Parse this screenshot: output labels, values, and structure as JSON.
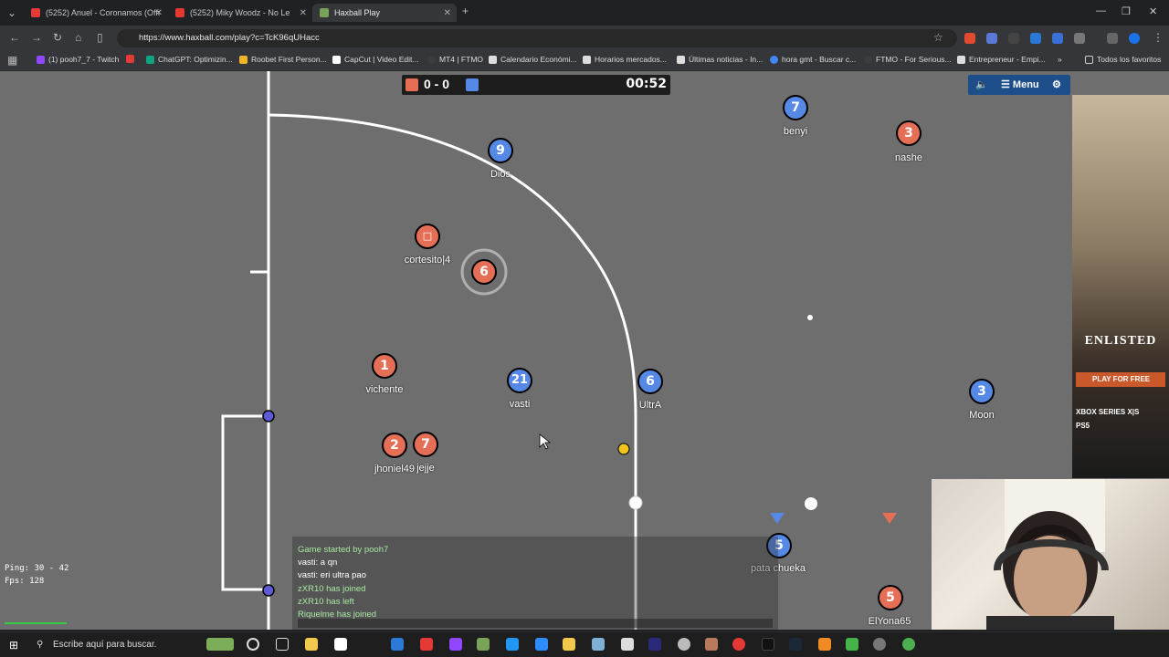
{
  "browser": {
    "tabs": [
      {
        "title": "(5252) Anuel - Coronamos (Offi",
        "color": "#e53935"
      },
      {
        "title": "(5252) Miky Woodz - No Le",
        "color": "#e53935"
      },
      {
        "title": "Haxball Play",
        "color": "#7aa35a"
      }
    ],
    "new_tab_glyph": "+",
    "url": "https://www.haxball.com/play?c=TcK96qUHacc",
    "bookmarks": [
      {
        "label": "(1) pooh7_7 - Twitch",
        "color": "#9146ff"
      },
      {
        "label": "ChatGPT: Optimizin...",
        "color": "#10a37f"
      },
      {
        "label": "Roobet First Person...",
        "color": "#f0b429"
      },
      {
        "label": "CapCut | Video Edit...",
        "color": "#ffffff"
      },
      {
        "label": "MT4 | FTMO",
        "color": "#3c3c3c"
      },
      {
        "label": "Calendario Económi...",
        "color": "#dddddd"
      },
      {
        "label": "Horarios mercados...",
        "color": "#dddddd"
      },
      {
        "label": "Últimas noticias - In...",
        "color": "#dddddd"
      },
      {
        "label": "hora gmt - Buscar c...",
        "color": "#4285f4"
      },
      {
        "label": "FTMO - For Serious...",
        "color": "#3c3c3c"
      },
      {
        "label": "Entrepreneur - Empi...",
        "color": "#dddddd"
      }
    ],
    "all_bookmarks": "Todos los favoritos"
  },
  "game": {
    "score": "0 - 0",
    "timer": "00:52",
    "red_color": "#e56e56",
    "blue_color": "#5689e5",
    "menu_label": "Menu",
    "players": [
      {
        "number": "9",
        "name": "Dios",
        "team": "blue"
      },
      {
        "number": "7",
        "name": "benyi",
        "team": "blue"
      },
      {
        "number": "3",
        "name": "nashe",
        "team": "red"
      },
      {
        "number": "□",
        "name": "cortesito|4",
        "team": "red"
      },
      {
        "number": "6",
        "name": "",
        "team": "red"
      },
      {
        "number": "1",
        "name": "vichente",
        "team": "red"
      },
      {
        "number": "21",
        "name": "vasti",
        "team": "blue"
      },
      {
        "number": "6",
        "name": "UltrA",
        "team": "blue"
      },
      {
        "number": "3",
        "name": "Moon",
        "team": "blue"
      },
      {
        "number": "2",
        "name": "jhoniel49",
        "team": "red"
      },
      {
        "number": "7",
        "name": "jejje",
        "team": "red"
      },
      {
        "number": "5",
        "name": "pata chueka",
        "team": "blue"
      },
      {
        "number": "5",
        "name": "ElYona65",
        "team": "red"
      }
    ],
    "chat": [
      {
        "text": "Game started by pooh7",
        "system": true
      },
      {
        "text": "vasti: a qn",
        "system": false
      },
      {
        "text": "vasti: eri ultra pao",
        "system": false
      },
      {
        "text": "zXR10 has joined",
        "system": true
      },
      {
        "text": "zXR10 has left",
        "system": true
      },
      {
        "text": "Riquelme has joined",
        "system": true
      }
    ],
    "ping": "Ping: 30 - 42",
    "fps": "Fps: 128"
  },
  "ad": {
    "title": "ENLISTED",
    "button": "PLAY FOR FREE",
    "platform1": "XBOX SERIES X|S",
    "platform2": "PS5"
  },
  "taskbar": {
    "search_placeholder": "Escribe aquí para buscar."
  }
}
